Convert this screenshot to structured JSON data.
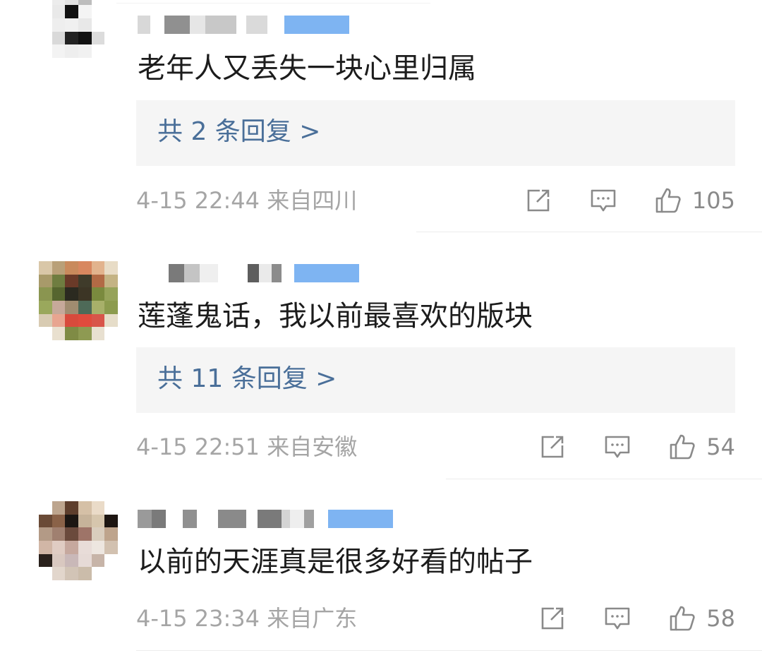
{
  "comments": [
    {
      "text": "老年人又丢失一块心里归属",
      "replies_label": "共 2 条回复 >",
      "date": "4-15 22:44",
      "location": "来自四川",
      "likes": "105"
    },
    {
      "text": "莲蓬鬼话，我以前最喜欢的版块",
      "replies_label": "共 11 条回复 >",
      "date": "4-15 22:51",
      "location": "来自安徽",
      "likes": "54"
    },
    {
      "text": "以前的天涯真是很多好看的帖子",
      "date": "4-15 23:34",
      "location": "来自广东",
      "likes": "58"
    }
  ],
  "icons": {
    "share": "share-icon",
    "comment": "comment-icon",
    "like": "thumbs-up-icon"
  },
  "colors": {
    "reply_link": "#4a6f99",
    "reply_box": "#f5f5f5",
    "meta_text": "#a5a5a5",
    "icon": "#8a8a8a",
    "verified_badge": "#7eb4f2"
  }
}
